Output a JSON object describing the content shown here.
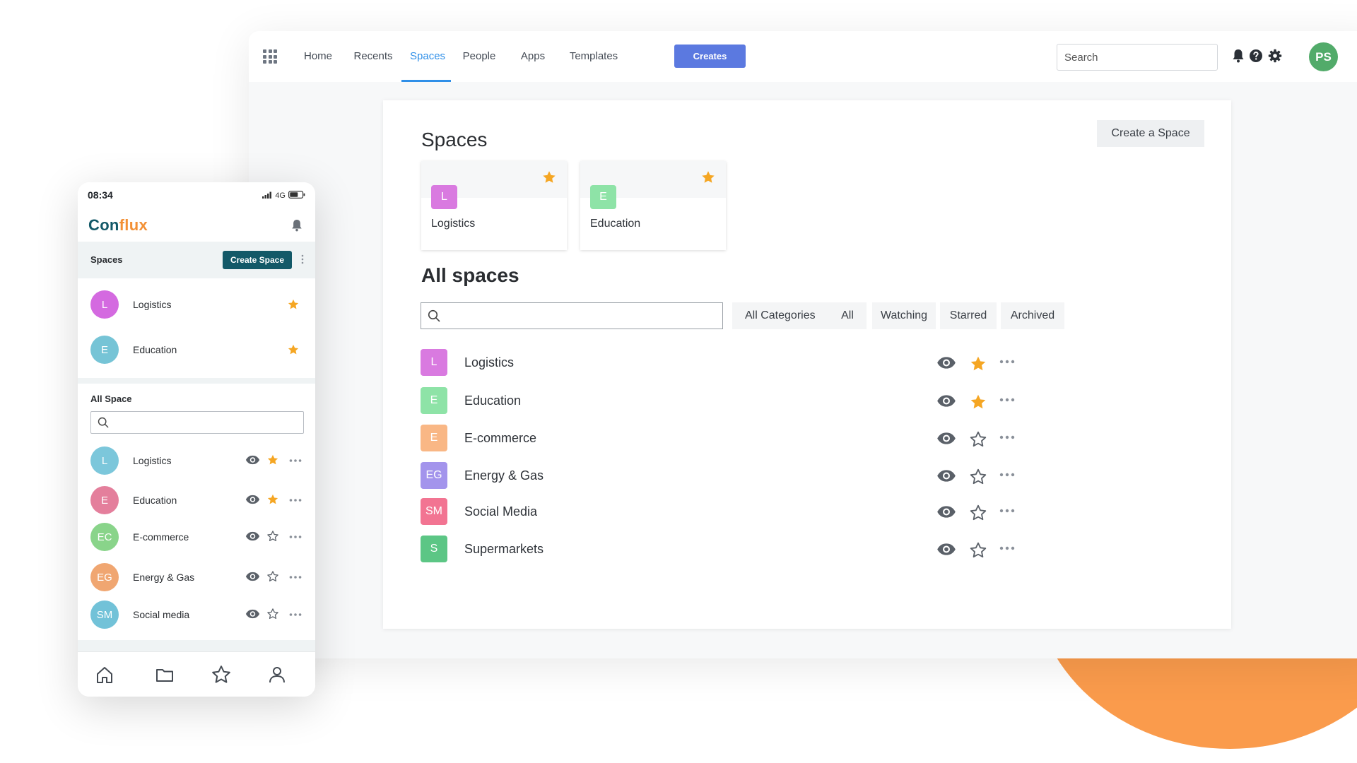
{
  "colors": {
    "accent_blue": "#2f8fe8",
    "creates_button": "#5b79e0",
    "star_filled": "#f5a623",
    "mobile_brand": "#135968",
    "mobile_brand_orange": "#f39035",
    "decoration_orange": "#fa9b4c"
  },
  "desktop": {
    "nav": [
      "Home",
      "Recents",
      "Spaces",
      "People",
      "Apps",
      "Templates"
    ],
    "active_nav": "Spaces",
    "creates_label": "Creates",
    "search_placeholder": "Search",
    "icons": [
      "apps-grid-icon",
      "bell-icon",
      "help-icon",
      "settings-icon"
    ],
    "avatar_initials": "PS",
    "spaces_heading": "Spaces",
    "create_space_label": "Create a Space",
    "favorites": [
      {
        "letter": "L",
        "name": "Logistics",
        "color": "#d97ae0",
        "starred": true
      },
      {
        "letter": "E",
        "name": "Education",
        "color": "#8ee3a7",
        "starred": true
      }
    ],
    "all_spaces_heading": "All spaces",
    "filter_search_placeholder": "",
    "category_select": "All Categories",
    "filter_tabs": [
      "All",
      "Watching",
      "Starred",
      "Archived"
    ],
    "spaces": [
      {
        "letter": "L",
        "name": "Logistics",
        "color": "#d97ae0",
        "starred": true
      },
      {
        "letter": "E",
        "name": "Education",
        "color": "#8ee3a7",
        "starred": true
      },
      {
        "letter": "E",
        "name": "E-commerce",
        "color": "#f9b785",
        "starred": false
      },
      {
        "letter": "EG",
        "name": "Energy & Gas",
        "color": "#a394ec",
        "starred": false
      },
      {
        "letter": "SM",
        "name": "Social Media",
        "color": "#f27492",
        "starred": false
      },
      {
        "letter": "S",
        "name": "Supermarkets",
        "color": "#5cc685",
        "starred": false
      }
    ]
  },
  "mobile": {
    "time": "08:34",
    "network": "4G",
    "logo_part1": "Con",
    "logo_part2": "flux",
    "spaces_label": "Spaces",
    "create_space_label": "Create Space",
    "favorites": [
      {
        "letter": "L",
        "name": "Logistics",
        "color": "#d46ae0",
        "starred": true
      },
      {
        "letter": "E",
        "name": "Education",
        "color": "#76c4d6",
        "starred": true
      }
    ],
    "all_space_label": "All Space",
    "search_placeholder": "",
    "spaces": [
      {
        "letter": "L",
        "name": "Logistics",
        "color": "#7cc7db",
        "starred": true
      },
      {
        "letter": "E",
        "name": "Education",
        "color": "#e47f9c",
        "starred": true
      },
      {
        "letter": "EC",
        "name": "E-commerce",
        "color": "#89d48a",
        "starred": false
      },
      {
        "letter": "EG",
        "name": "Energy & Gas",
        "color": "#f0a671",
        "starred": false
      },
      {
        "letter": "SM",
        "name": "Social media",
        "color": "#72c2d8",
        "starred": false
      }
    ],
    "tabs": [
      "home-icon",
      "folder-icon",
      "star-icon",
      "profile-icon"
    ]
  }
}
